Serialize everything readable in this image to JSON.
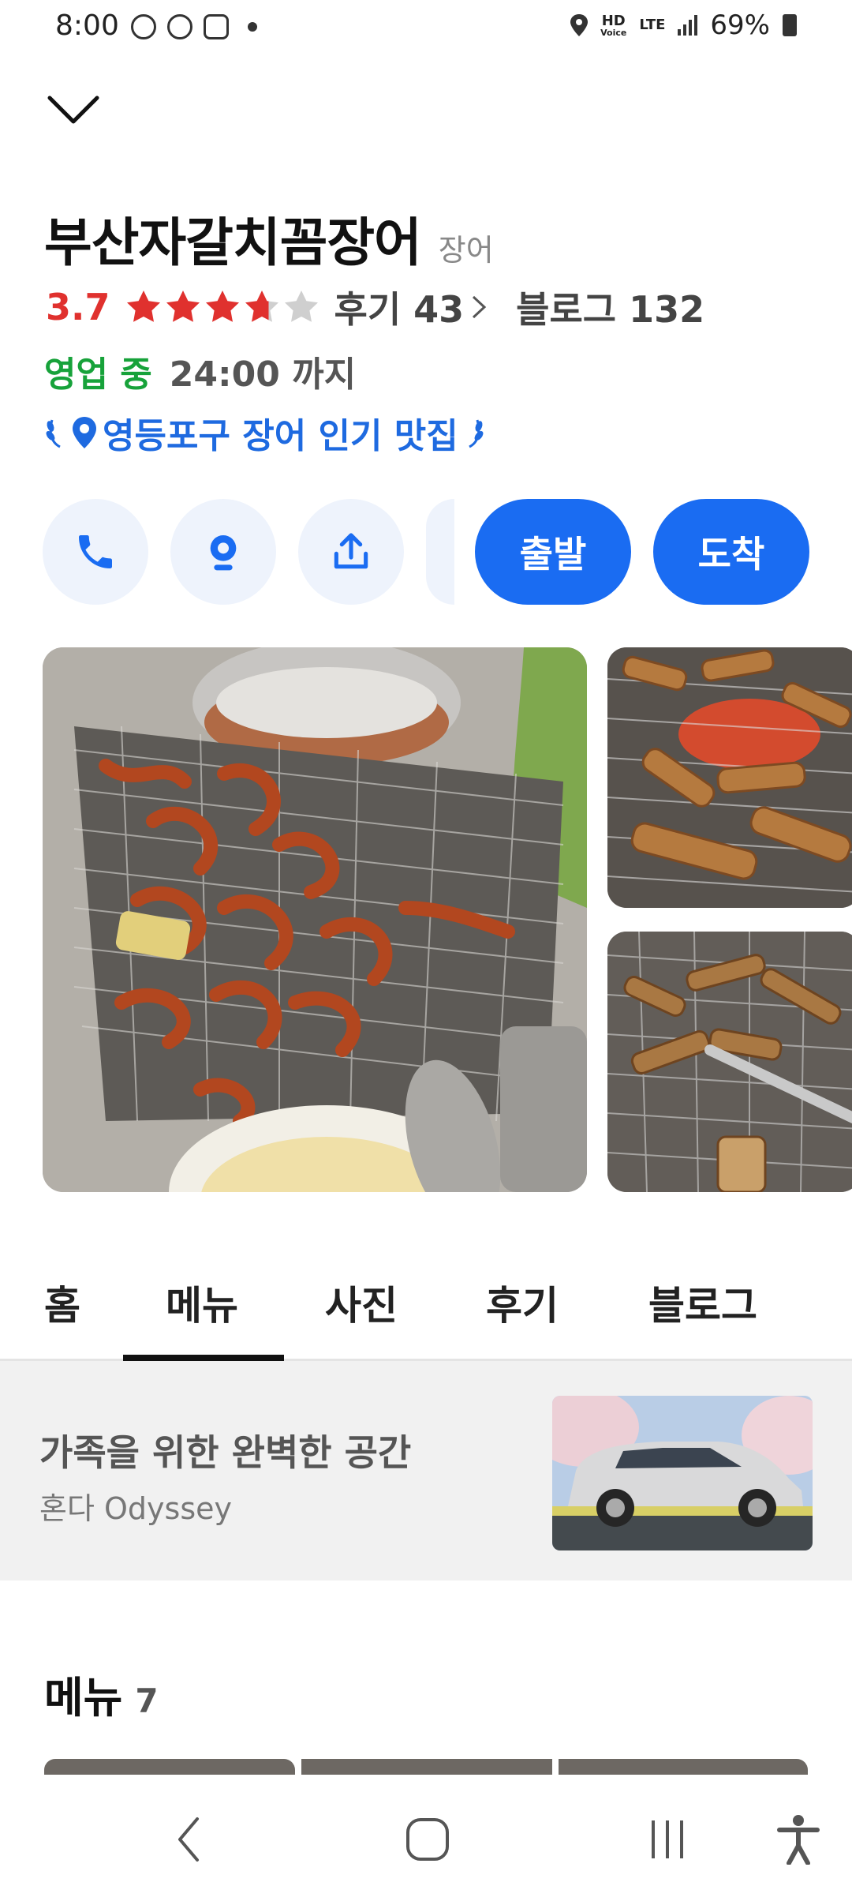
{
  "status_bar": {
    "time": "8:00",
    "network_hd": "HD",
    "network_voice": "Voice",
    "network_lte": "LTE",
    "battery": "69%"
  },
  "place": {
    "name": "부산자갈치꼼장어",
    "category": "장어",
    "rating": "3.7",
    "rating_value": 3.7,
    "review_label": "후기 43",
    "blog_label": "블로그 132",
    "open_status": "영업 중",
    "hours": "24:00 까지",
    "badge": "영등포구 장어 인기 맛집"
  },
  "actions": {
    "call_icon": "phone-icon",
    "save_icon": "map-pin-icon",
    "share_icon": "share-icon",
    "depart_label": "출발",
    "arrive_label": "도착"
  },
  "tabs": [
    {
      "label": "홈"
    },
    {
      "label": "메뉴"
    },
    {
      "label": "사진"
    },
    {
      "label": "후기"
    },
    {
      "label": "블로그"
    }
  ],
  "active_tab": "메뉴",
  "ad": {
    "title": "가족을 위한 완벽한 공간",
    "subtitle": "혼다 Odyssey"
  },
  "menu_section": {
    "title": "메뉴",
    "count": "7"
  },
  "colors": {
    "accent_blue": "#1a6cf2",
    "rating_red": "#e0312e",
    "open_green": "#17a23a"
  }
}
